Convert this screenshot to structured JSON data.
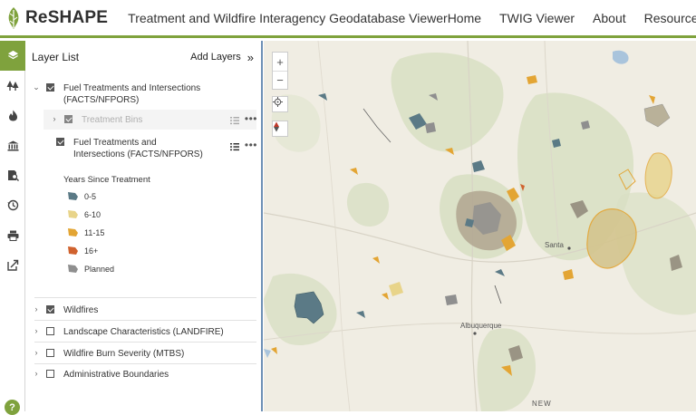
{
  "header": {
    "logo_text": "ReSHAPE",
    "app_title": "Treatment and Wildfire Interagency Geodatabase Viewer",
    "nav": [
      "Home",
      "TWIG Viewer",
      "About",
      "Resources"
    ]
  },
  "iconbar": {
    "icons": [
      "layers-icon",
      "tree-icon",
      "fire-icon",
      "building-icon",
      "search-map-icon",
      "history-icon",
      "print-icon",
      "share-icon"
    ],
    "help": "?"
  },
  "panel": {
    "title": "Layer List",
    "add_layers": "Add Layers",
    "add_layers_chevron": "»",
    "group": {
      "label": "Fuel Treatments and Intersections (FACTS/NFPORS)",
      "sublayers": [
        {
          "label": "Treatment Bins",
          "checked": true,
          "dimmed": true
        },
        {
          "label": "Fuel Treatments and Intersections (FACTS/NFPORS)",
          "checked": true,
          "dimmed": false
        }
      ]
    },
    "legend": {
      "title": "Years Since Treatment",
      "items": [
        {
          "label": "0-5",
          "color": "#5b7a86"
        },
        {
          "label": "6-10",
          "color": "#e8d48a"
        },
        {
          "label": "11-15",
          "color": "#e3a534"
        },
        {
          "label": "16+",
          "color": "#d0622e"
        },
        {
          "label": "Planned",
          "color": "#8f8f8f"
        }
      ]
    },
    "layers": [
      {
        "label": "Wildfires",
        "checked": true
      },
      {
        "label": "Landscape Characteristics (LANDFIRE)",
        "checked": false
      },
      {
        "label": "Wildfire Burn Severity (MTBS)",
        "checked": false
      },
      {
        "label": "Administrative Boundaries",
        "checked": false
      }
    ]
  },
  "map": {
    "zoom_in": "+",
    "zoom_out": "−",
    "labels": {
      "santa": "Santa",
      "albuquerque": "Albuquerque",
      "new": "NEW"
    },
    "colors": {
      "base": "#f0ede3",
      "forest": "#d8dfc3",
      "accent": "#7fa23d"
    }
  }
}
